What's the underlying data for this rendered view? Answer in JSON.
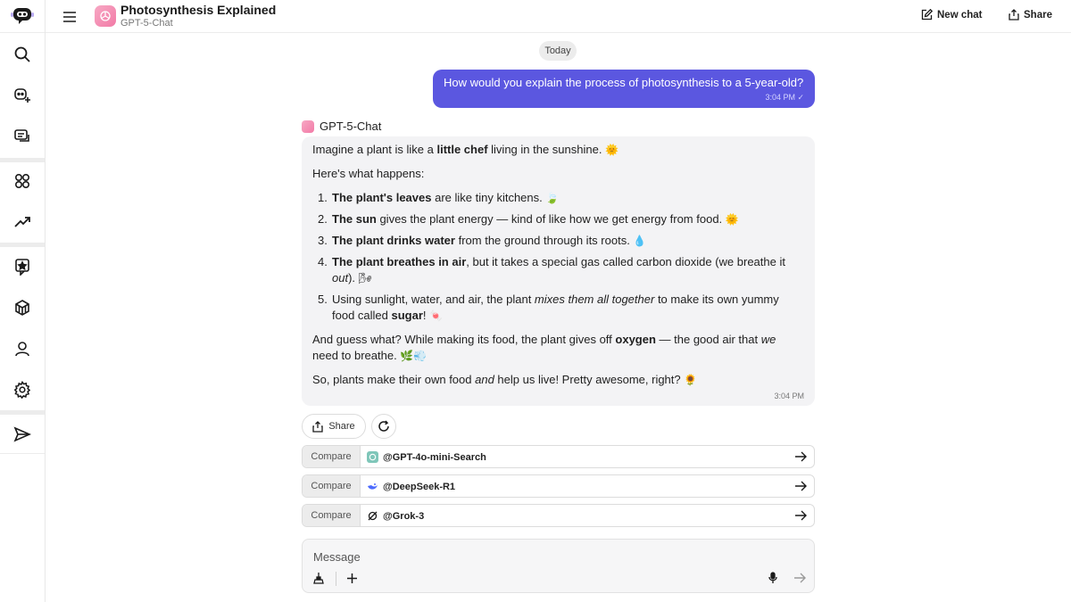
{
  "header": {
    "title": "Photosynthesis Explained",
    "subtitle": "GPT-5-Chat",
    "new_chat_label": "New chat",
    "share_label": "Share"
  },
  "sidebar": {
    "items": [
      {
        "name": "search-icon"
      },
      {
        "name": "bot-add-icon"
      },
      {
        "name": "chats-icon"
      },
      {
        "name": "apps-grid-icon"
      },
      {
        "name": "trending-icon"
      },
      {
        "name": "star-chat-icon"
      },
      {
        "name": "cube-icon"
      },
      {
        "name": "user-icon"
      },
      {
        "name": "settings-icon"
      },
      {
        "name": "send-icon"
      }
    ]
  },
  "chat": {
    "date_label": "Today",
    "user_message": {
      "text": "How would you explain the process of photosynthesis to a 5-year-old?",
      "time": "3:04 PM ✓"
    },
    "bot_name": "GPT-5-Chat",
    "bot_message": {
      "intro_pre": "Imagine a plant is like a ",
      "intro_bold": "little chef",
      "intro_post": " living in the sunshine. ",
      "intro_emoji": "🌞",
      "lead": "Here's what happens:",
      "items": [
        {
          "num": "1.",
          "bold": "The plant's leaves",
          "text": " are like tiny kitchens. ",
          "emoji": "🍃"
        },
        {
          "num": "2.",
          "bold": "The sun",
          "text": " gives the plant energy — kind of like how we get energy from food. ",
          "emoji": "🌞"
        },
        {
          "num": "3.",
          "bold": "The plant drinks water",
          "text": " from the ground through its roots. ",
          "emoji": "💧"
        },
        {
          "num": "4.",
          "bold": "The plant breathes in air",
          "text": ", but it takes a special gas called carbon dioxide (we breathe it",
          "line2_italic": "out",
          "line2_post": "). ",
          "emoji": "🌬"
        },
        {
          "num": "5.",
          "text": "Using sunlight, water, and air, the plant ",
          "italic": "mixes them all together",
          "text2": " to make its own yummy",
          "line2_pre": "food called ",
          "line2_bold": "sugar",
          "line2_post": "! ",
          "emoji": "🍬"
        }
      ],
      "para2_pre": "And guess what? While making its food, the plant gives off ",
      "para2_bold": "oxygen",
      "para2_mid": " — the good air that ",
      "para2_italic": "we",
      "para2_line2": "need to breathe. ",
      "para2_emoji": "🌿💨",
      "para3_pre": "So, plants make their own food ",
      "para3_italic": "and",
      "para3_post": " help us live! Pretty awesome, right? ",
      "para3_emoji": "🌻",
      "time": "3:04 PM"
    },
    "share_chip_label": "Share"
  },
  "compare": {
    "tag": "Compare",
    "rows": [
      {
        "name": "@GPT-4o-mini-Search",
        "icon": "openai-icon"
      },
      {
        "name": "@DeepSeek-R1",
        "icon": "deepseek-icon"
      },
      {
        "name": "@Grok-3",
        "icon": "grok-icon"
      }
    ]
  },
  "composer": {
    "placeholder": "Message"
  },
  "colors": {
    "accent": "#5b57e0",
    "bot_bubble": "#f3f3f5"
  }
}
